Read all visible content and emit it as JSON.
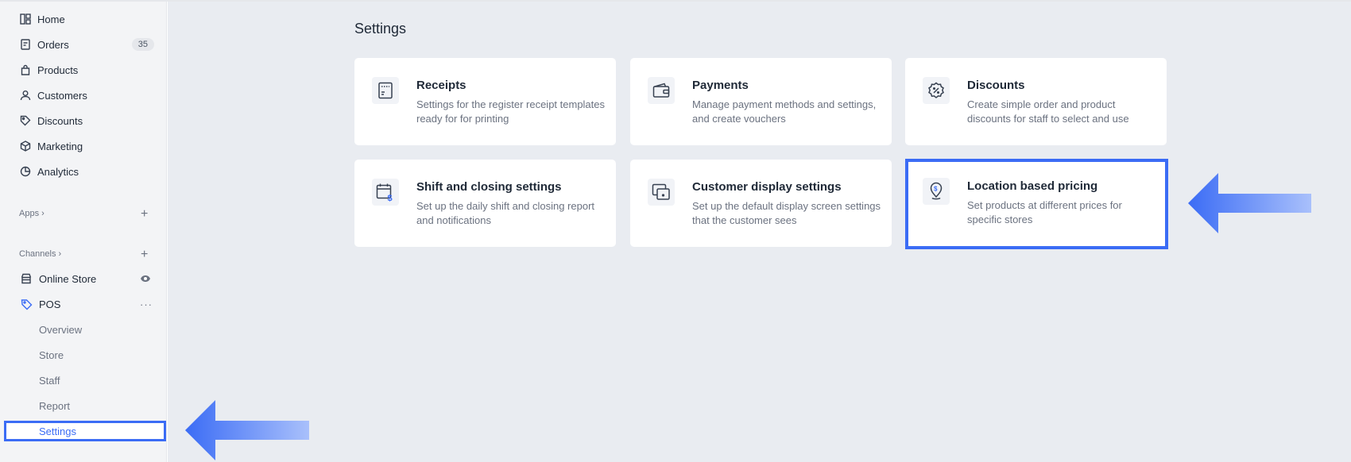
{
  "sidebar": {
    "nav": [
      {
        "label": "Home",
        "icon": "home-icon"
      },
      {
        "label": "Orders",
        "icon": "orders-icon",
        "badge": "35"
      },
      {
        "label": "Products",
        "icon": "products-icon"
      },
      {
        "label": "Customers",
        "icon": "customers-icon"
      },
      {
        "label": "Discounts",
        "icon": "discounts-icon"
      },
      {
        "label": "Marketing",
        "icon": "marketing-icon"
      },
      {
        "label": "Analytics",
        "icon": "analytics-icon"
      }
    ],
    "apps_label": "Apps",
    "channels_label": "Channels",
    "channels": [
      {
        "label": "Online Store",
        "icon": "store-icon",
        "right_icon": "eye-icon"
      },
      {
        "label": "POS",
        "icon": "pos-icon",
        "right_icon": "more-icon"
      }
    ],
    "pos_sub": [
      "Overview",
      "Store",
      "Staff",
      "Report",
      "Settings"
    ],
    "active_item": "Settings"
  },
  "main": {
    "title": "Settings",
    "cards": [
      {
        "title": "Receipts",
        "desc": "Settings for the register receipt templates ready for for printing",
        "icon": "receipt-icon"
      },
      {
        "title": "Payments",
        "desc": "Manage payment methods and settings, and create vouchers",
        "icon": "wallet-icon"
      },
      {
        "title": "Discounts",
        "desc": "Create simple order and product discounts for staff to select and use",
        "icon": "discount-badge-icon"
      },
      {
        "title": "Shift and closing settings",
        "desc": "Set up the daily shift and closing report and notifications",
        "icon": "calendar-dollar-icon"
      },
      {
        "title": "Customer display settings",
        "desc": "Set up the default display screen settings that the customer sees",
        "icon": "display-icon"
      },
      {
        "title": "Location based pricing",
        "desc": "Set products at different prices for specific stores",
        "icon": "location-dollar-icon"
      }
    ],
    "highlighted_card": "Location based pricing"
  },
  "colors": {
    "accent": "#3b6cf5",
    "main_bg": "#e9ecf1",
    "sidebar_bg": "#f3f4f6"
  }
}
